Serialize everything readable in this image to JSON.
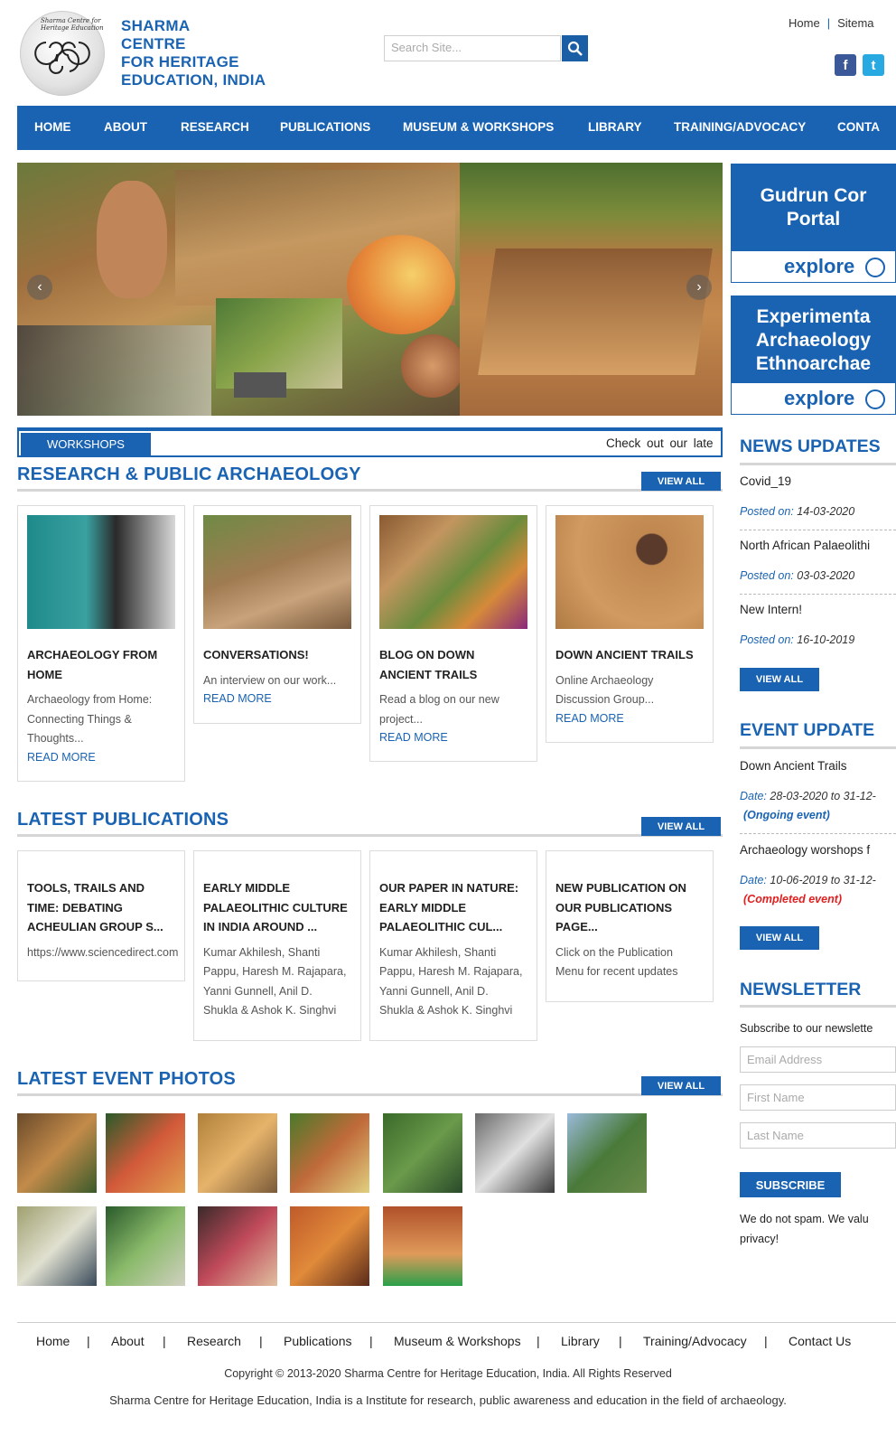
{
  "header": {
    "logo_text": "Sharma Centre for Heritage Education",
    "brand_lines": [
      "SHARMA",
      "CENTRE",
      "FOR HERITAGE",
      "EDUCATION, INDIA"
    ],
    "search_placeholder": "Search Site...",
    "top_links": [
      "Home",
      "Sitema"
    ],
    "social": [
      "f",
      "t"
    ]
  },
  "nav": [
    "HOME",
    "ABOUT",
    "RESEARCH",
    "PUBLICATIONS",
    "MUSEUM & WORKSHOPS",
    "LIBRARY",
    "TRAINING/ADVOCACY",
    "CONTA"
  ],
  "slider": {
    "prev": "‹",
    "next": "›"
  },
  "promos": [
    {
      "title_lines": [
        "Gudrun Cor",
        "Portal"
      ],
      "cta": "explore"
    },
    {
      "title_lines": [
        "Experimenta",
        "Archaeology",
        "Ethnoarchae"
      ],
      "cta": "explore"
    }
  ],
  "ticker": {
    "label": "WORKSHOPS",
    "text": "Check out our late"
  },
  "research": {
    "heading": "RESEARCH & PUBLIC ARCHAEOLOGY",
    "view_all": "VIEW ALL",
    "cards": [
      {
        "title_lines": [
          "ARCHAEOLOGY FROM",
          "HOME"
        ],
        "excerpt_lines": [
          "Archaeology from Home:",
          "Connecting Things &",
          "Thoughts..."
        ],
        "read_more": "READ MORE"
      },
      {
        "title_lines": [
          "CONVERSATIONS!"
        ],
        "excerpt_lines": [
          "An interview on our work..."
        ],
        "read_more": "READ MORE"
      },
      {
        "title_lines": [
          "BLOG ON DOWN",
          "ANCIENT TRAILS"
        ],
        "excerpt_lines": [
          "Read a blog on our new",
          "project..."
        ],
        "read_more": "READ MORE"
      },
      {
        "title_lines": [
          "DOWN ANCIENT TRAILS"
        ],
        "excerpt_lines": [
          "Online Archaeology",
          "Discussion Group..."
        ],
        "read_more": "READ MORE"
      }
    ]
  },
  "publications": {
    "heading": "LATEST PUBLICATIONS",
    "view_all": "VIEW ALL",
    "cards": [
      {
        "title_lines": [
          "TOOLS, TRAILS AND",
          "TIME: DEBATING",
          "ACHEULIAN GROUP S..."
        ],
        "text_lines": [
          "https://www.sciencedirect.com"
        ]
      },
      {
        "title_lines": [
          "EARLY MIDDLE",
          "PALAEOLITHIC CULTURE",
          "IN INDIA AROUND ..."
        ],
        "text_lines": [
          "Kumar Akhilesh, Shanti",
          "Pappu, Haresh M. Rajapara,",
          "Yanni Gunnell, Anil D.",
          "Shukla & Ashok K. Singhvi"
        ]
      },
      {
        "title_lines": [
          "OUR PAPER IN NATURE:",
          "EARLY MIDDLE",
          "PALAEOLITHIC CUL..."
        ],
        "text_lines": [
          "Kumar Akhilesh, Shanti",
          "Pappu, Haresh M. Rajapara,",
          "Yanni Gunnell, Anil D.",
          "Shukla & Ashok K. Singhvi"
        ]
      },
      {
        "title_lines": [
          "NEW PUBLICATION ON",
          "OUR PUBLICATIONS",
          "PAGE..."
        ],
        "text_lines": [
          "Click on the Publication",
          "Menu for recent updates"
        ]
      }
    ]
  },
  "photos": {
    "heading": "LATEST EVENT PHOTOS",
    "view_all": "VIEW ALL"
  },
  "news": {
    "heading": "NEWS UPDATES",
    "items": [
      {
        "title": "Covid_19",
        "posted_label": "Posted on:",
        "date": "14-03-2020"
      },
      {
        "title": "North African Palaeolithi",
        "posted_label": "Posted on:",
        "date": "03-03-2020"
      },
      {
        "title": "New Intern!",
        "posted_label": "Posted on:",
        "date": "16-10-2019"
      }
    ],
    "view_all": "VIEW ALL"
  },
  "events": {
    "heading": "EVENT UPDATE",
    "items": [
      {
        "title": "Down Ancient Trails",
        "date_label": "Date:",
        "date": "28-03-2020 to 31-12-",
        "status": "(Ongoing event)",
        "status_color": "#1a63b2"
      },
      {
        "title": "Archaeology worshops f",
        "date_label": "Date:",
        "date": "10-06-2019 to 31-12-",
        "status": "(Completed event)",
        "status_color": "#e02020"
      }
    ],
    "view_all": "VIEW ALL"
  },
  "newsletter": {
    "heading": "NEWSLETTER",
    "intro": "Subscribe to our newslette",
    "email_placeholder": "Email Address",
    "first_placeholder": "First Name",
    "last_placeholder": "Last Name",
    "button": "SUBSCRIBE",
    "note_lines": [
      "We do not spam. We valu",
      "privacy!"
    ]
  },
  "footer": {
    "links": [
      "Home",
      "About",
      "Research",
      "Publications",
      "Museum & Workshops",
      "Library",
      "Training/Advocacy",
      "Contact Us"
    ],
    "separator": "|",
    "copyright": "Copyright © 2013-2020 Sharma Centre for Heritage Education, India. All Rights Reserved",
    "tagline": "Sharma Centre for Heritage Education, India is a Institute for research, public awareness and education in the field of archaeology."
  },
  "colors": {
    "brand_blue": "#1a63b2",
    "facebook": "#3b5998",
    "twitter": "#29a9e1"
  }
}
